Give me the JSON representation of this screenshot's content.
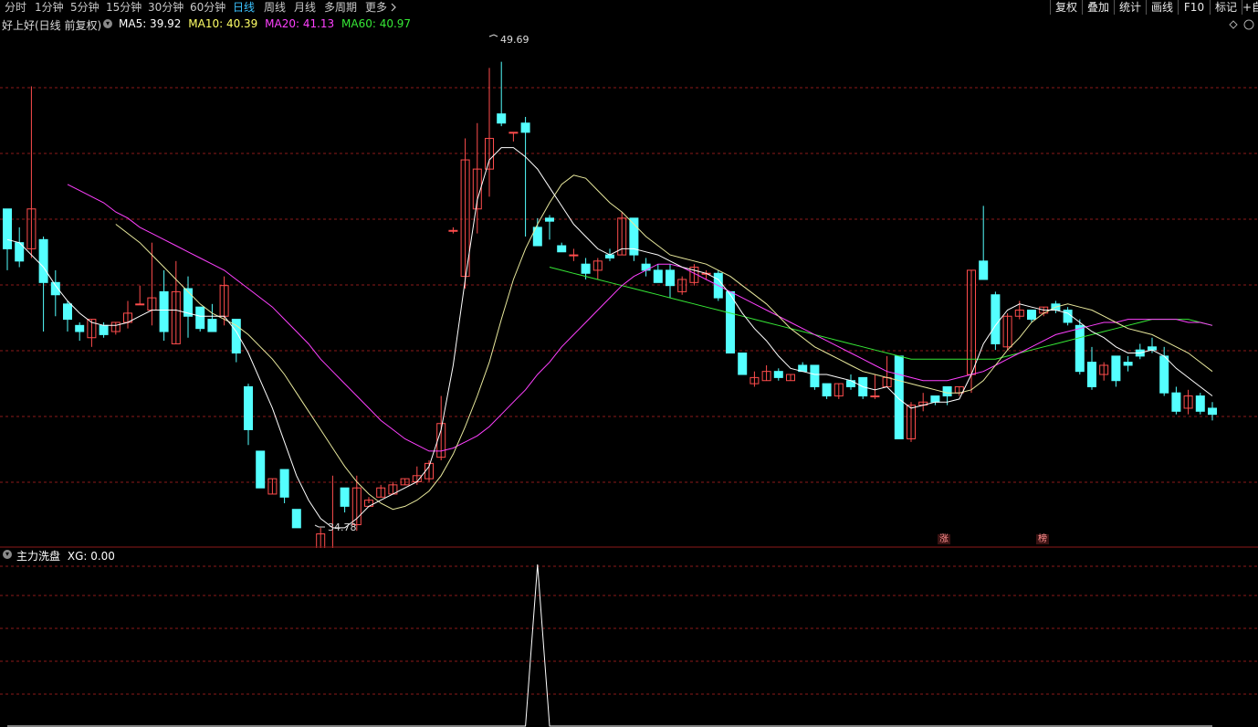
{
  "toolbar": {
    "periods": [
      "分时",
      "1分钟",
      "5分钟",
      "15分钟",
      "30分钟",
      "60分钟",
      "日线",
      "周线",
      "月线",
      "多周期",
      "更多"
    ],
    "active_period": "日线",
    "right_buttons": [
      "复权",
      "叠加",
      "统计",
      "画线",
      "F10",
      "标记",
      "+自"
    ]
  },
  "chart_header": {
    "name": "好上好(日线 前复权)",
    "ma5": "MA5: 39.92",
    "ma10": "MA10: 40.39",
    "ma20": "MA20: 41.13",
    "ma60": "MA60: 40.97"
  },
  "colors": {
    "up": "#ff4d4d",
    "down": "#54ffff",
    "ma5": "#ffffff",
    "ma10": "#e8e89c",
    "ma20": "#ff40ff",
    "ma60": "#36e836",
    "grid": "#8b1a1a",
    "indicator": "#ffffff"
  },
  "indicator_header": {
    "name": "主力洗盘",
    "value": "XG: 0.00"
  },
  "markers": {
    "high": "49.69",
    "low": "34.78"
  },
  "signals": [
    "涨",
    "榜"
  ],
  "icons": [
    "chevron-down-icon",
    "chevron-right-icon",
    "diamond-icon",
    "circle-icon"
  ],
  "chart_data": {
    "type": "candlestick",
    "ylim": [
      33.9,
      51.0
    ],
    "candles": [
      [
        44.9,
        43.6,
        44.9,
        42.9
      ],
      [
        43.8,
        43.2,
        44.3,
        43.0
      ],
      [
        43.6,
        44.9,
        48.9,
        43.3
      ],
      [
        43.9,
        42.5,
        44.0,
        40.9
      ],
      [
        42.5,
        42.1,
        42.9,
        41.4
      ],
      [
        41.8,
        41.3,
        41.9,
        40.9
      ],
      [
        41.1,
        40.9,
        41.2,
        40.6
      ],
      [
        40.7,
        41.3,
        41.3,
        40.4
      ],
      [
        41.1,
        40.8,
        41.2,
        40.7
      ],
      [
        40.9,
        41.2,
        41.2,
        40.8
      ],
      [
        41.2,
        41.5,
        41.9,
        41.0
      ],
      [
        41.8,
        41.8,
        42.4,
        41.8
      ],
      [
        41.6,
        42.0,
        43.8,
        41.1
      ],
      [
        42.2,
        40.9,
        42.9,
        40.6
      ],
      [
        40.5,
        42.2,
        43.2,
        40.5
      ],
      [
        42.3,
        41.4,
        42.7,
        40.7
      ],
      [
        41.7,
        41.0,
        41.7,
        40.9
      ],
      [
        41.3,
        40.9,
        41.8,
        40.9
      ],
      [
        41.4,
        42.4,
        42.7,
        41.1
      ],
      [
        41.3,
        40.2,
        41.3,
        39.9
      ],
      [
        39.1,
        37.7,
        39.2,
        37.2
      ],
      [
        37.0,
        35.8,
        37.0,
        35.8
      ],
      [
        35.6,
        36.1,
        36.1,
        35.6
      ],
      [
        36.4,
        35.5,
        36.4,
        35.3
      ],
      [
        35.1,
        34.5,
        35.1,
        34.5
      ],
      [
        33.6,
        33.2,
        33.6,
        33.2
      ],
      [
        33.2,
        34.3,
        34.5,
        33.2
      ],
      [
        33.6,
        33.6,
        36.2,
        33.5
      ],
      [
        35.8,
        35.2,
        35.8,
        35.0
      ],
      [
        34.6,
        35.8,
        36.2,
        34.4
      ],
      [
        35.2,
        35.4,
        35.5,
        35.3
      ],
      [
        35.5,
        35.8,
        35.9,
        35.5
      ],
      [
        35.6,
        35.9,
        36.0,
        35.6
      ],
      [
        35.9,
        36.1,
        36.1,
        35.9
      ],
      [
        36.0,
        36.2,
        36.5,
        35.9
      ],
      [
        36.1,
        36.6,
        36.7,
        36.0
      ],
      [
        36.8,
        37.9,
        38.8,
        36.7
      ],
      [
        44.2,
        44.2,
        44.3,
        44.1
      ],
      [
        42.7,
        46.5,
        47.2,
        42.3
      ],
      [
        44.9,
        46.2,
        47.7,
        44.1
      ],
      [
        46.2,
        47.2,
        49.5,
        45.3
      ],
      [
        48.0,
        47.7,
        49.7,
        47.6
      ],
      [
        47.4,
        47.4,
        47.4,
        47.1
      ],
      [
        47.7,
        47.4,
        47.9,
        44.0
      ],
      [
        44.3,
        43.7,
        44.6,
        43.7
      ],
      [
        44.6,
        44.5,
        44.7,
        43.9
      ],
      [
        43.7,
        43.5,
        43.8,
        43.5
      ],
      [
        43.4,
        43.4,
        43.6,
        43.2
      ],
      [
        43.1,
        42.8,
        43.3,
        42.6
      ],
      [
        42.9,
        43.2,
        43.3,
        42.6
      ],
      [
        43.4,
        43.3,
        43.6,
        43.2
      ],
      [
        43.4,
        44.6,
        44.8,
        43.4
      ],
      [
        44.6,
        43.4,
        44.6,
        43.2
      ],
      [
        43.1,
        42.9,
        43.3,
        42.7
      ],
      [
        42.9,
        42.5,
        43.1,
        42.5
      ],
      [
        42.9,
        42.4,
        43.1,
        42.0
      ],
      [
        42.2,
        42.6,
        42.7,
        42.1
      ],
      [
        42.5,
        43.0,
        43.1,
        42.4
      ],
      [
        42.8,
        42.8,
        42.9,
        42.6
      ],
      [
        42.8,
        42.0,
        42.9,
        41.9
      ],
      [
        42.2,
        40.2,
        42.2,
        40.2
      ],
      [
        40.2,
        39.5,
        40.2,
        39.5
      ],
      [
        39.2,
        39.4,
        39.6,
        39.1
      ],
      [
        39.3,
        39.6,
        39.8,
        39.3
      ],
      [
        39.6,
        39.4,
        39.7,
        39.3
      ],
      [
        39.3,
        39.5,
        39.5,
        39.3
      ],
      [
        39.8,
        39.6,
        39.9,
        39.6
      ],
      [
        39.8,
        39.1,
        39.8,
        39.0
      ],
      [
        39.2,
        38.8,
        39.2,
        38.7
      ],
      [
        38.8,
        39.2,
        39.2,
        38.7
      ],
      [
        39.3,
        39.1,
        39.5,
        39.0
      ],
      [
        39.4,
        38.8,
        39.4,
        38.7
      ],
      [
        38.8,
        38.8,
        39.5,
        38.7
      ],
      [
        39.1,
        39.4,
        40.1,
        39.1
      ],
      [
        40.1,
        37.4,
        40.1,
        37.4
      ],
      [
        37.4,
        38.5,
        38.6,
        37.3
      ],
      [
        38.5,
        38.6,
        38.9,
        38.3
      ],
      [
        38.8,
        38.6,
        38.8,
        38.5
      ],
      [
        39.1,
        38.8,
        39.1,
        38.5
      ],
      [
        38.9,
        39.1,
        39.1,
        38.8
      ],
      [
        39.5,
        42.9,
        42.9,
        38.9
      ],
      [
        43.2,
        42.6,
        45.0,
        42.6
      ],
      [
        42.1,
        40.5,
        42.2,
        40.3
      ],
      [
        40.4,
        41.4,
        41.5,
        40.3
      ],
      [
        41.4,
        41.6,
        41.9,
        41.3
      ],
      [
        41.6,
        41.3,
        41.6,
        41.2
      ],
      [
        41.5,
        41.7,
        41.7,
        41.4
      ],
      [
        41.8,
        41.6,
        41.9,
        41.5
      ],
      [
        41.6,
        41.2,
        41.7,
        41.1
      ],
      [
        41.1,
        39.6,
        41.3,
        39.5
      ],
      [
        39.9,
        39.1,
        40.4,
        39.0
      ],
      [
        39.5,
        39.8,
        39.9,
        39.3
      ],
      [
        40.1,
        39.3,
        40.1,
        39.1
      ],
      [
        39.9,
        39.8,
        40.1,
        39.6
      ],
      [
        40.3,
        40.1,
        40.5,
        40.0
      ],
      [
        40.4,
        40.3,
        40.7,
        40.2
      ],
      [
        40.1,
        38.9,
        40.4,
        38.8
      ],
      [
        38.9,
        38.3,
        39.1,
        38.2
      ],
      [
        38.4,
        38.8,
        39.0,
        38.2
      ],
      [
        38.8,
        38.3,
        38.9,
        38.2
      ],
      [
        38.4,
        38.2,
        38.6,
        38.0
      ]
    ],
    "ma5": [
      43.9,
      43.8,
      43.4,
      43.0,
      42.4,
      41.9,
      41.5,
      41.2,
      41.1,
      41.1,
      41.2,
      41.4,
      41.6,
      41.6,
      41.6,
      41.5,
      41.4,
      41.4,
      41.4,
      40.9,
      40.2,
      39.3,
      38.4,
      37.3,
      36.2,
      35.4,
      34.8,
      34.5,
      34.5,
      34.8,
      35.2,
      35.4,
      35.6,
      35.8,
      36.0,
      36.5,
      37.7,
      39.8,
      42.6,
      45.2,
      46.5,
      46.9,
      46.9,
      46.6,
      46.2,
      45.6,
      45.0,
      44.4,
      44.0,
      43.6,
      43.4,
      43.6,
      43.6,
      43.5,
      43.4,
      43.2,
      43.0,
      42.9,
      42.8,
      42.6,
      42.1,
      41.5,
      41.0,
      40.6,
      40.1,
      39.7,
      39.6,
      39.5,
      39.5,
      39.4,
      39.3,
      39.1,
      39.0,
      39.1,
      38.7,
      38.4,
      38.5,
      38.6,
      38.6,
      38.7,
      39.5,
      40.5,
      41.1,
      41.6,
      41.8,
      41.7,
      41.6,
      41.6,
      41.5,
      41.2,
      40.9,
      40.7,
      40.4,
      40.2,
      40.2,
      40.3,
      40.1,
      39.7,
      39.4,
      39.1,
      38.8
    ],
    "ma10": [
      null,
      null,
      null,
      null,
      null,
      null,
      null,
      null,
      null,
      44.4,
      44.1,
      43.8,
      43.4,
      43.0,
      42.6,
      42.2,
      41.8,
      41.5,
      41.3,
      41.1,
      40.8,
      40.4,
      40.0,
      39.5,
      38.9,
      38.3,
      37.7,
      37.1,
      36.5,
      36.0,
      35.6,
      35.3,
      35.1,
      35.2,
      35.4,
      35.7,
      36.2,
      36.9,
      37.8,
      38.8,
      39.9,
      41.3,
      42.6,
      43.6,
      44.4,
      45.1,
      45.7,
      46.0,
      45.9,
      45.5,
      45.1,
      44.8,
      44.4,
      44.0,
      43.7,
      43.4,
      43.3,
      43.2,
      43.1,
      42.9,
      42.7,
      42.4,
      42.1,
      41.8,
      41.4,
      41.0,
      40.7,
      40.4,
      40.2,
      40.0,
      39.8,
      39.6,
      39.5,
      39.4,
      39.3,
      39.2,
      39.1,
      39.0,
      38.9,
      38.9,
      39.0,
      39.3,
      39.8,
      40.3,
      40.7,
      41.2,
      41.5,
      41.7,
      41.8,
      41.7,
      41.6,
      41.4,
      41.2,
      41.0,
      40.9,
      40.8,
      40.6,
      40.4,
      40.2,
      39.9,
      39.6
    ],
    "ma20": [
      null,
      null,
      null,
      null,
      null,
      45.7,
      45.5,
      45.3,
      45.1,
      44.8,
      44.6,
      44.3,
      44.1,
      43.9,
      43.7,
      43.5,
      43.3,
      43.1,
      42.9,
      42.6,
      42.3,
      42.0,
      41.7,
      41.3,
      40.9,
      40.5,
      40.0,
      39.6,
      39.2,
      38.8,
      38.4,
      38.0,
      37.7,
      37.4,
      37.2,
      37.0,
      37.0,
      37.1,
      37.3,
      37.5,
      37.8,
      38.2,
      38.6,
      39.0,
      39.5,
      39.9,
      40.4,
      40.8,
      41.2,
      41.6,
      42.0,
      42.4,
      42.7,
      42.9,
      43.1,
      43.1,
      43.0,
      42.8,
      42.6,
      42.4,
      42.2,
      42.0,
      41.8,
      41.6,
      41.4,
      41.2,
      41.0,
      40.8,
      40.6,
      40.4,
      40.2,
      40.0,
      39.8,
      39.6,
      39.5,
      39.4,
      39.3,
      39.3,
      39.3,
      39.4,
      39.5,
      39.6,
      39.8,
      40.0,
      40.2,
      40.4,
      40.6,
      40.8,
      40.9,
      41.0,
      41.1,
      41.2,
      41.2,
      41.3,
      41.3,
      41.3,
      41.3,
      41.3,
      41.2,
      41.2,
      41.1
    ],
    "ma60": [
      null,
      null,
      null,
      null,
      null,
      null,
      null,
      null,
      null,
      null,
      null,
      null,
      null,
      null,
      null,
      null,
      null,
      null,
      null,
      null,
      null,
      null,
      null,
      null,
      null,
      null,
      null,
      null,
      null,
      null,
      null,
      null,
      null,
      null,
      null,
      null,
      null,
      null,
      null,
      null,
      null,
      null,
      null,
      null,
      null,
      43.0,
      42.9,
      42.8,
      42.7,
      42.6,
      42.5,
      42.4,
      42.3,
      42.2,
      42.1,
      42.0,
      41.9,
      41.8,
      41.7,
      41.6,
      41.5,
      41.4,
      41.3,
      41.2,
      41.1,
      41.0,
      40.9,
      40.8,
      40.7,
      40.6,
      40.5,
      40.4,
      40.3,
      40.2,
      40.1,
      40.0,
      40.0,
      40.0,
      40.0,
      40.0,
      40.0,
      40.0,
      40.0,
      40.1,
      40.2,
      40.3,
      40.4,
      40.5,
      40.6,
      40.7,
      40.8,
      40.9,
      41.0,
      41.1,
      41.2,
      41.3,
      41.3,
      41.3,
      41.3,
      41.2,
      41.1
    ],
    "xg": [
      0,
      0,
      0,
      0,
      0,
      0,
      0,
      0,
      0,
      0,
      0,
      0,
      0,
      0,
      0,
      0,
      0,
      0,
      0,
      0,
      0,
      0,
      0,
      0,
      0,
      0,
      0,
      0,
      0,
      0,
      0,
      0,
      0,
      0,
      0,
      0,
      0,
      0,
      0,
      0,
      0,
      0,
      0,
      0,
      1,
      0,
      0,
      0,
      0,
      0,
      0,
      0,
      0,
      0,
      0,
      0,
      0,
      0,
      0,
      0,
      0,
      0,
      0,
      0,
      0,
      0,
      0,
      0,
      0,
      0,
      0,
      0,
      0,
      0,
      0,
      0,
      0,
      0,
      0,
      0,
      0,
      0,
      0,
      0,
      0,
      0,
      0,
      0,
      0,
      0,
      0,
      0,
      0,
      0,
      0,
      0,
      0,
      0,
      0,
      0,
      0
    ]
  }
}
